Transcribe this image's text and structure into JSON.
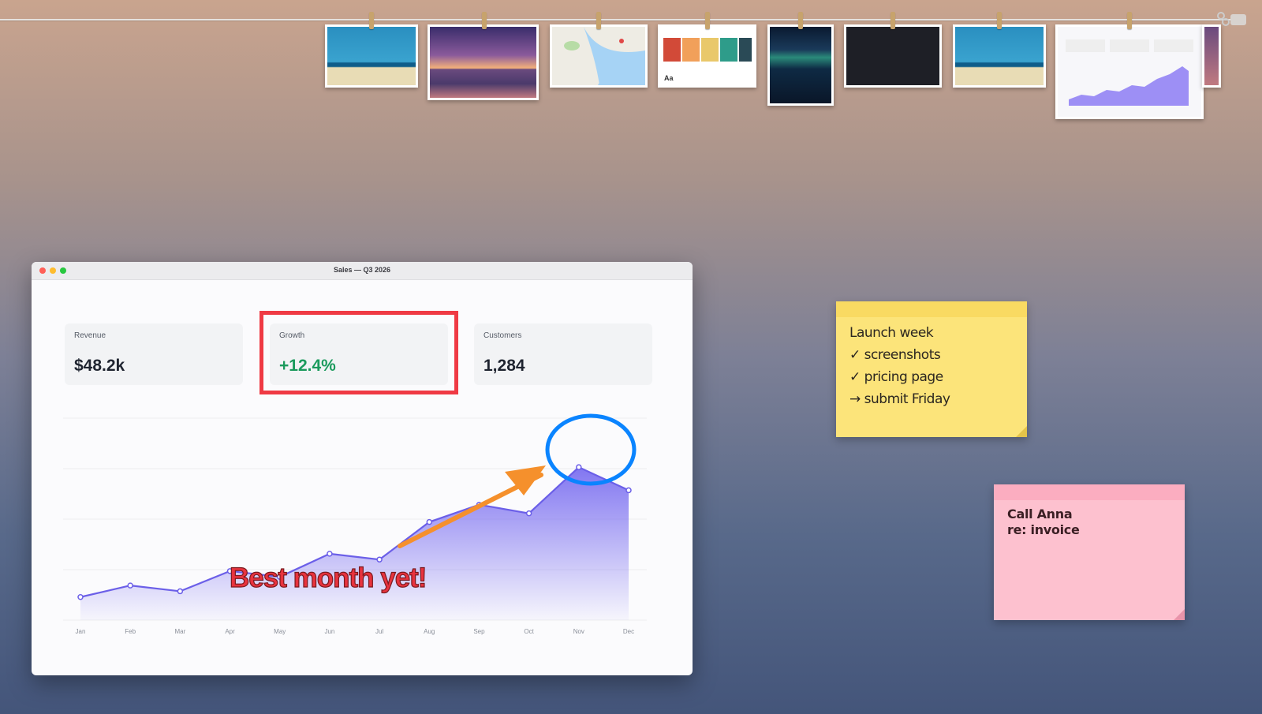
{
  "window": {
    "title": "Sales — Q3 2026"
  },
  "cards": [
    {
      "label": "Revenue",
      "value": "$48.2k"
    },
    {
      "label": "Growth",
      "value": "+12.4%",
      "color": "#1a9a5c"
    },
    {
      "label": "Customers",
      "value": "1,284"
    }
  ],
  "chart_data": {
    "type": "area",
    "categories": [
      "Jan",
      "Feb",
      "Mar",
      "Apr",
      "May",
      "Jun",
      "Jul",
      "Aug",
      "Sep",
      "Oct",
      "Nov",
      "Dec"
    ],
    "series": [
      {
        "values": [
          8,
          12,
          10,
          17,
          15,
          23,
          21,
          34,
          40,
          37,
          53,
          45
        ],
        "color": "#6b5fe8"
      }
    ],
    "ylim": [
      0,
      70
    ],
    "grid": true
  },
  "annotations": {
    "callout_text": "Best month yet!",
    "callout_color": "#e8333e",
    "arrow_color": "#f5902c",
    "circle_color": "#0a84ff"
  },
  "sticky_notes": {
    "yellow": [
      "Launch week",
      "✓ screenshots",
      "✓ pricing page",
      "→ submit Friday"
    ],
    "pink": [
      "Call Anna",
      "re: invoice"
    ]
  }
}
